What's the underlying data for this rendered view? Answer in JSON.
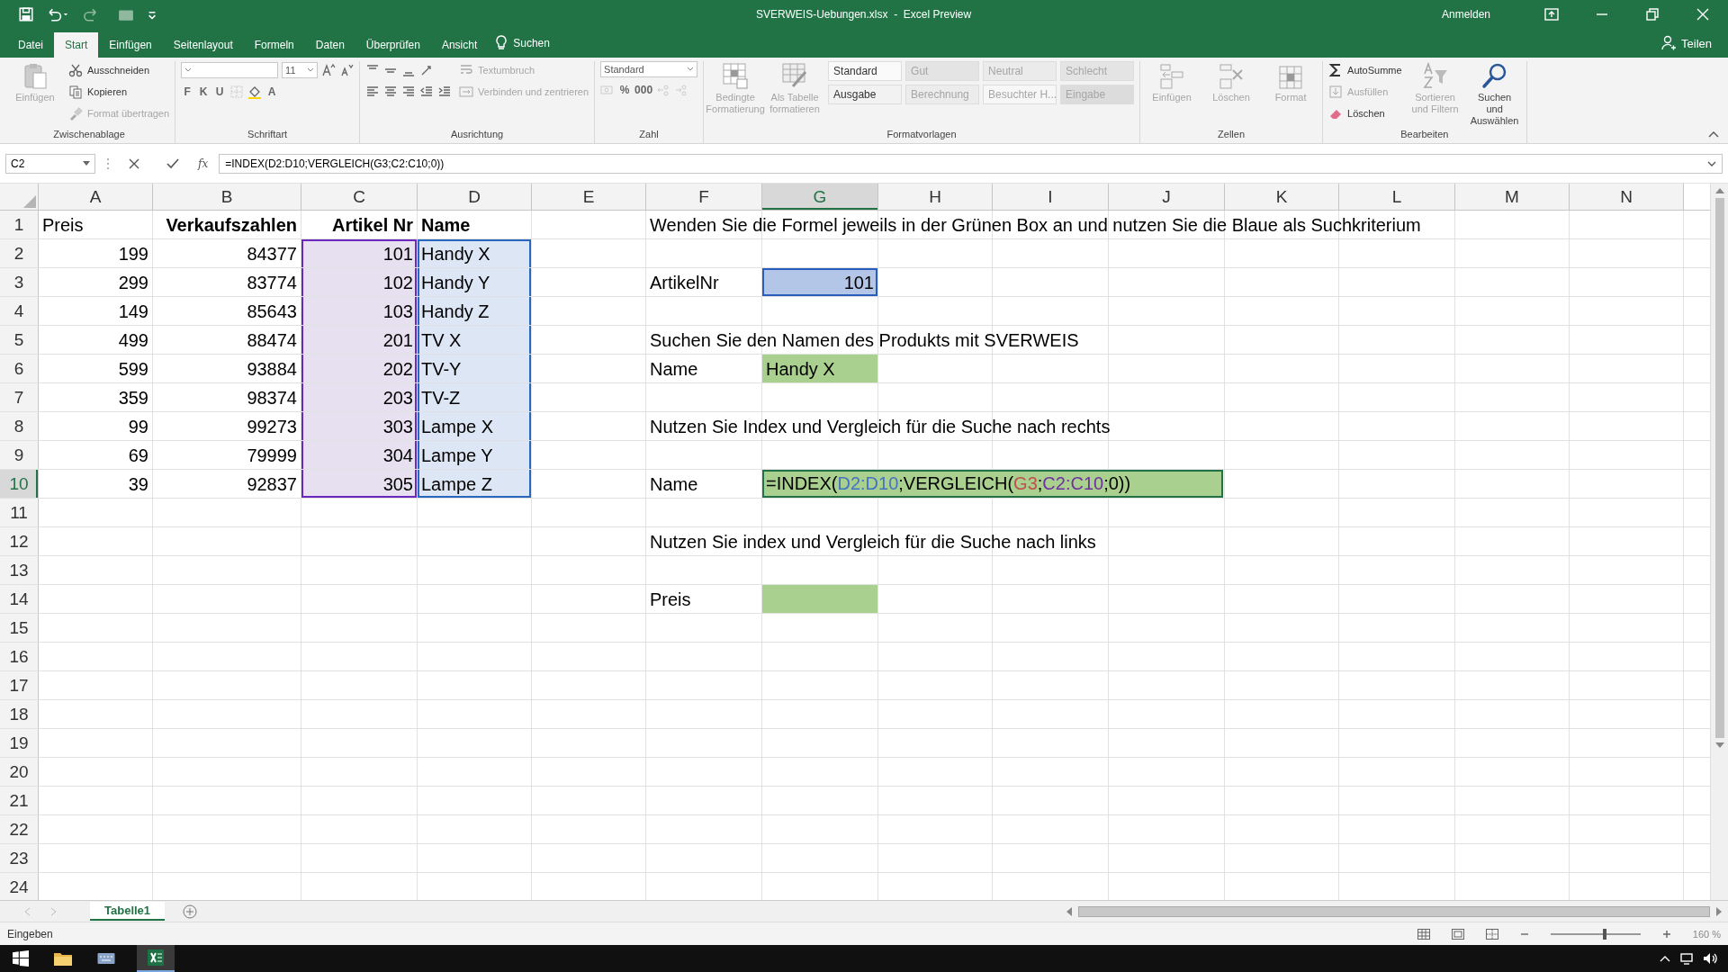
{
  "window": {
    "title": "SVERWEIS-Uebungen.xlsx  -  Excel Preview",
    "account": "Anmelden"
  },
  "ribbon_tabs": [
    {
      "label": "Datei",
      "selected": false
    },
    {
      "label": "Start",
      "selected": true
    },
    {
      "label": "Einfügen",
      "selected": false
    },
    {
      "label": "Seitenlayout",
      "selected": false
    },
    {
      "label": "Formeln",
      "selected": false
    },
    {
      "label": "Daten",
      "selected": false
    },
    {
      "label": "Überprüfen",
      "selected": false
    },
    {
      "label": "Ansicht",
      "selected": false
    }
  ],
  "tell_me": {
    "label": "Suchen"
  },
  "share": {
    "label": "Teilen"
  },
  "ribbon_groups": [
    {
      "label": "Zwischenablage",
      "columns": [
        [
          [
            {
              "kind": "large",
              "label": "Einfügen",
              "disabled": true
            }
          ]
        ],
        [
          [
            {
              "kind": "button",
              "label": "Ausschneiden",
              "disabled": false
            }
          ],
          [
            {
              "kind": "button",
              "label": "Kopieren",
              "disabled": false
            }
          ],
          [
            {
              "kind": "button",
              "label": "Format übertragen",
              "disabled": true
            }
          ]
        ]
      ]
    },
    {
      "label": "Schriftart",
      "columns": [
        [
          [
            {
              "kind": "combo",
              "disabled": false
            },
            {
              "kind": "field",
              "value": "11",
              "disabled": false
            },
            {
              "kind": "icon",
              "disabled": false
            },
            {
              "kind": "icon",
              "disabled": false
            }
          ],
          [
            {
              "kind": "glyph",
              "label": "F",
              "disabled": false
            },
            {
              "kind": "glyph",
              "label": "K",
              "disabled": false
            },
            {
              "kind": "glyph",
              "label": "U",
              "disabled": false
            },
            {
              "kind": "icon",
              "disabled": true
            },
            {
              "kind": "icon",
              "disabled": false
            },
            {
              "kind": "glyph",
              "label": "A",
              "disabled": false
            }
          ]
        ]
      ]
    },
    {
      "label": "Ausrichtung",
      "columns": [
        [
          [
            {
              "kind": "icon",
              "disabled": false
            },
            {
              "kind": "icon",
              "disabled": false
            },
            {
              "kind": "icon",
              "disabled": false
            },
            {
              "kind": "icon",
              "disabled": false
            }
          ],
          [
            {
              "kind": "icon",
              "disabled": false
            },
            {
              "kind": "icon",
              "disabled": false
            },
            {
              "kind": "icon",
              "disabled": false
            },
            {
              "kind": "icon",
              "disabled": false
            },
            {
              "kind": "icon",
              "disabled": false
            }
          ]
        ],
        [
          [
            {
              "kind": "button",
              "label": "Textumbruch",
              "disabled": true
            }
          ],
          [
            {
              "kind": "button",
              "label": "Verbinden und zentrieren",
              "disabled": true
            }
          ]
        ]
      ]
    },
    {
      "label": "Zahl",
      "columns": [
        [
          [
            {
              "kind": "combo",
              "value": "Standard",
              "disabled": false
            }
          ],
          [
            {
              "kind": "icon",
              "disabled": true
            },
            {
              "kind": "glyph",
              "label": "%",
              "disabled": false
            },
            {
              "kind": "glyph",
              "label": "000",
              "disabled": false
            },
            {
              "kind": "icon",
              "disabled": true
            },
            {
              "kind": "icon",
              "disabled": true
            }
          ]
        ]
      ]
    },
    {
      "label": "Formatvorlagen",
      "columns": [
        [
          [
            {
              "kind": "large",
              "label": "Bedingte Formatierung",
              "disabled": true
            }
          ]
        ],
        [
          [
            {
              "kind": "large",
              "label": "Als Tabelle formatieren",
              "disabled": true
            }
          ]
        ],
        [
          [
            {
              "kind": "style",
              "label": "Standard",
              "color": "#fafafa",
              "disabled": false
            },
            {
              "kind": "style",
              "label": "Gut",
              "color": "#e4e4e4",
              "disabled": true
            },
            {
              "kind": "style",
              "label": "Neutral",
              "color": "#ebebeb",
              "disabled": true
            },
            {
              "kind": "style",
              "label": "Schlecht",
              "color": "#e4e4e4",
              "disabled": true
            }
          ],
          [
            {
              "kind": "style",
              "label": "Ausgabe",
              "color": "#f2f2f2",
              "disabled": false
            },
            {
              "kind": "style",
              "label": "Berechnung",
              "color": "#ececec",
              "disabled": true
            },
            {
              "kind": "style",
              "label": "Besuchter H...",
              "color": "#f7f7f7",
              "disabled": true
            },
            {
              "kind": "style",
              "label": "Eingabe",
              "color": "#dcdcdc",
              "disabled": true
            }
          ]
        ]
      ]
    },
    {
      "label": "Zellen",
      "columns": [
        [
          [
            {
              "kind": "large",
              "label": "Einfügen",
              "disabled": true
            }
          ]
        ],
        [
          [
            {
              "kind": "large",
              "label": "Löschen",
              "disabled": true
            }
          ]
        ],
        [
          [
            {
              "kind": "large",
              "label": "Format",
              "disabled": true
            }
          ]
        ]
      ]
    },
    {
      "label": "Bearbeiten",
      "columns": [
        [
          [
            {
              "kind": "button",
              "label": "AutoSumme",
              "disabled": false
            }
          ],
          [
            {
              "kind": "button",
              "label": "Ausfüllen",
              "disabled": true
            }
          ],
          [
            {
              "kind": "button",
              "label": "Löschen",
              "disabled": false
            }
          ]
        ],
        [
          [
            {
              "kind": "large",
              "label": "Sortieren und Filtern",
              "disabled": true
            }
          ]
        ],
        [
          [
            {
              "kind": "large",
              "label": "Suchen und Auswählen",
              "disabled": false
            }
          ]
        ]
      ]
    }
  ],
  "formula_bar": {
    "name_box": "C2",
    "function_label": "fx",
    "formula": "=INDEX(D2:D10;VERGLEICH(G3;C2:C10;0))"
  },
  "sheet": {
    "columns": [
      {
        "label": "A",
        "selected": false
      },
      {
        "label": "B",
        "selected": false
      },
      {
        "label": "C",
        "selected": false
      },
      {
        "label": "D",
        "selected": false
      },
      {
        "label": "E",
        "selected": false
      },
      {
        "label": "F",
        "selected": false
      },
      {
        "label": "G",
        "selected": true
      },
      {
        "label": "H",
        "selected": false
      },
      {
        "label": "I",
        "selected": false
      },
      {
        "label": "J",
        "selected": false
      },
      {
        "label": "K",
        "selected": false
      },
      {
        "label": "L",
        "selected": false
      },
      {
        "label": "M",
        "selected": false
      },
      {
        "label": "N",
        "selected": false
      }
    ],
    "rows": [
      {
        "label": "1",
        "selected": false,
        "cells": [
          {
            "kind": "text",
            "text": "Preis"
          },
          {
            "kind": "label",
            "text": "Verkaufszahlen"
          },
          {
            "kind": "label",
            "text": "Artikel Nr"
          },
          {
            "kind": "heading",
            "text": "Name"
          },
          null,
          {
            "kind": "text",
            "text": "Wenden Sie die Formel jeweils in der Grünen Box an und nutzen Sie die Blaue als Suchkriterium"
          },
          null,
          null,
          null,
          null,
          null,
          null,
          null,
          null
        ]
      },
      {
        "label": "2",
        "selected": false,
        "cells": [
          {
            "kind": "number",
            "text": "199"
          },
          {
            "kind": "number",
            "text": "84377"
          },
          {
            "kind": "number",
            "text": "101",
            "color": "#e7e0f0",
            "framed": true
          },
          {
            "kind": "text",
            "text": "Handy X",
            "color": "#dce6f4",
            "framed": true
          },
          null,
          null,
          null,
          null,
          null,
          null,
          null,
          null,
          null,
          null
        ]
      },
      {
        "label": "3",
        "selected": false,
        "cells": [
          {
            "kind": "number",
            "text": "299"
          },
          {
            "kind": "number",
            "text": "83774"
          },
          {
            "kind": "number",
            "text": "102",
            "color": "#e7e0f0",
            "framed": true
          },
          {
            "kind": "text",
            "text": "Handy Y",
            "color": "#dce6f4",
            "framed": true
          },
          null,
          {
            "kind": "text",
            "text": "ArtikelNr"
          },
          {
            "kind": "number",
            "text": "101",
            "color": "#b4c6e7",
            "framed": true
          },
          null,
          null,
          null,
          null,
          null,
          null,
          null
        ]
      },
      {
        "label": "4",
        "selected": false,
        "cells": [
          {
            "kind": "number",
            "text": "149"
          },
          {
            "kind": "number",
            "text": "85643"
          },
          {
            "kind": "number",
            "text": "103",
            "color": "#e7e0f0",
            "framed": true
          },
          {
            "kind": "text",
            "text": "Handy Z",
            "color": "#dce6f4",
            "framed": true
          },
          null,
          null,
          null,
          null,
          null,
          null,
          null,
          null,
          null,
          null
        ]
      },
      {
        "label": "5",
        "selected": false,
        "cells": [
          {
            "kind": "number",
            "text": "499"
          },
          {
            "kind": "number",
            "text": "88474"
          },
          {
            "kind": "number",
            "text": "201",
            "color": "#e7e0f0",
            "framed": true
          },
          {
            "kind": "text",
            "text": "TV X",
            "color": "#dce6f4",
            "framed": true
          },
          null,
          {
            "kind": "text",
            "text": "Suchen Sie den Namen des Produkts mit SVERWEIS"
          },
          null,
          null,
          null,
          null,
          null,
          null,
          null,
          null
        ]
      },
      {
        "label": "6",
        "selected": false,
        "cells": [
          {
            "kind": "number",
            "text": "599"
          },
          {
            "kind": "number",
            "text": "93884"
          },
          {
            "kind": "number",
            "text": "202",
            "color": "#e7e0f0",
            "framed": true
          },
          {
            "kind": "text",
            "text": "TV-Y",
            "color": "#dce6f4",
            "framed": true
          },
          null,
          {
            "kind": "text",
            "text": "Name"
          },
          {
            "kind": "text",
            "text": "Handy X",
            "color": "#a9d08e",
            "framed": false
          },
          null,
          null,
          null,
          null,
          null,
          null,
          null
        ]
      },
      {
        "label": "7",
        "selected": false,
        "cells": [
          {
            "kind": "number",
            "text": "359"
          },
          {
            "kind": "number",
            "text": "98374"
          },
          {
            "kind": "number",
            "text": "203",
            "color": "#e7e0f0",
            "framed": true
          },
          {
            "kind": "text",
            "text": "TV-Z",
            "color": "#dce6f4",
            "framed": true
          },
          null,
          null,
          null,
          null,
          null,
          null,
          null,
          null,
          null,
          null
        ]
      },
      {
        "label": "8",
        "selected": false,
        "cells": [
          {
            "kind": "number",
            "text": "99"
          },
          {
            "kind": "number",
            "text": "99273"
          },
          {
            "kind": "number",
            "text": "303",
            "color": "#e7e0f0",
            "framed": true
          },
          {
            "kind": "text",
            "text": "Lampe X",
            "color": "#dce6f4",
            "framed": true
          },
          null,
          {
            "kind": "text",
            "text": "Nutzen Sie Index und Vergleich für die Suche nach rechts"
          },
          null,
          null,
          null,
          null,
          null,
          null,
          null,
          null
        ]
      },
      {
        "label": "9",
        "selected": false,
        "cells": [
          {
            "kind": "number",
            "text": "69"
          },
          {
            "kind": "number",
            "text": "79999"
          },
          {
            "kind": "number",
            "text": "304",
            "color": "#e7e0f0",
            "framed": true
          },
          {
            "kind": "text",
            "text": "Lampe Y",
            "color": "#dce6f4",
            "framed": true
          },
          null,
          null,
          null,
          null,
          null,
          null,
          null,
          null,
          null,
          null
        ]
      },
      {
        "label": "10",
        "selected": true,
        "cells": [
          {
            "kind": "number",
            "text": "39"
          },
          {
            "kind": "number",
            "text": "92837"
          },
          {
            "kind": "number",
            "text": "305",
            "color": "#e7e0f0",
            "framed": true
          },
          {
            "kind": "text",
            "text": "Lampe Z",
            "color": "#dce6f4",
            "framed": true
          },
          null,
          {
            "kind": "text",
            "text": "Name"
          },
          {
            "kind": "formula",
            "color": "#a9d08e",
            "parts": [
              {
                "text": "=INDEX(",
                "color": "#000000"
              },
              {
                "text": "D2:D10",
                "color": "#4472c4"
              },
              {
                "text": ";VERGLEICH(",
                "color": "#000000"
              },
              {
                "text": "G3",
                "color": "#c0504d"
              },
              {
                "text": ";",
                "color": "#000000"
              },
              {
                "text": "C2:C10",
                "color": "#7030a0"
              },
              {
                "text": ";0))",
                "color": "#000000"
              }
            ]
          },
          null,
          null,
          null,
          null,
          null,
          null,
          null
        ]
      },
      {
        "label": "11",
        "selected": false,
        "cells": [
          null,
          null,
          null,
          null,
          null,
          null,
          null,
          null,
          null,
          null,
          null,
          null,
          null,
          null
        ]
      },
      {
        "label": "12",
        "selected": false,
        "cells": [
          null,
          null,
          null,
          null,
          null,
          {
            "kind": "text",
            "text": "Nutzen Sie index und Vergleich für die Suche nach links"
          },
          null,
          null,
          null,
          null,
          null,
          null,
          null,
          null
        ]
      },
      {
        "label": "13",
        "selected": false,
        "cells": [
          null,
          null,
          null,
          null,
          null,
          null,
          null,
          null,
          null,
          null,
          null,
          null,
          null,
          null
        ]
      },
      {
        "label": "14",
        "selected": false,
        "cells": [
          null,
          null,
          null,
          null,
          null,
          {
            "kind": "text",
            "text": "Preis"
          },
          {
            "kind": "blank",
            "color": "#a9d08e",
            "framed": false
          },
          null,
          null,
          null,
          null,
          null,
          null,
          null
        ]
      },
      {
        "label": "15",
        "selected": false,
        "cells": [
          null,
          null,
          null,
          null,
          null,
          null,
          null,
          null,
          null,
          null,
          null,
          null,
          null,
          null
        ]
      },
      {
        "label": "16",
        "selected": false,
        "cells": [
          null,
          null,
          null,
          null,
          null,
          null,
          null,
          null,
          null,
          null,
          null,
          null,
          null,
          null
        ]
      },
      {
        "label": "17",
        "selected": false,
        "cells": [
          null,
          null,
          null,
          null,
          null,
          null,
          null,
          null,
          null,
          null,
          null,
          null,
          null,
          null
        ]
      },
      {
        "label": "18",
        "selected": false,
        "cells": [
          null,
          null,
          null,
          null,
          null,
          null,
          null,
          null,
          null,
          null,
          null,
          null,
          null,
          null
        ]
      },
      {
        "label": "19",
        "selected": false,
        "cells": [
          null,
          null,
          null,
          null,
          null,
          null,
          null,
          null,
          null,
          null,
          null,
          null,
          null,
          null
        ]
      },
      {
        "label": "20",
        "selected": false,
        "cells": [
          null,
          null,
          null,
          null,
          null,
          null,
          null,
          null,
          null,
          null,
          null,
          null,
          null,
          null
        ]
      },
      {
        "label": "21",
        "selected": false,
        "cells": [
          null,
          null,
          null,
          null,
          null,
          null,
          null,
          null,
          null,
          null,
          null,
          null,
          null,
          null
        ]
      },
      {
        "label": "22",
        "selected": false,
        "cells": [
          null,
          null,
          null,
          null,
          null,
          null,
          null,
          null,
          null,
          null,
          null,
          null,
          null,
          null
        ]
      },
      {
        "label": "23",
        "selected": false,
        "cells": [
          null,
          null,
          null,
          null,
          null,
          null,
          null,
          null,
          null,
          null,
          null,
          null,
          null,
          null
        ]
      },
      {
        "label": "24",
        "selected": false,
        "cells": [
          null,
          null,
          null,
          null,
          null,
          null,
          null,
          null,
          null,
          null,
          null,
          null,
          null,
          null
        ]
      }
    ]
  },
  "sheet_tabs": [
    {
      "label": "Tabelle1",
      "selected": true
    }
  ],
  "status_bar": {
    "mode": "Eingeben",
    "zoom": {
      "level": 0.6,
      "reading": "160 %"
    }
  }
}
